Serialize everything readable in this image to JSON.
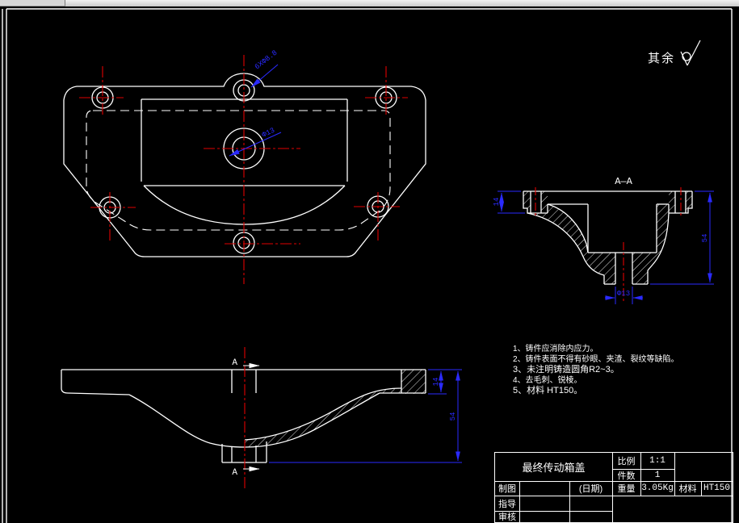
{
  "surface_finish": {
    "label": "其余"
  },
  "top_view": {
    "leader_bolt_holes": "6XΦ8.8",
    "leader_center_hole": "Φ13"
  },
  "section_view": {
    "title": "A—A",
    "dim_flange_thickness": "14",
    "dim_total_height": "54",
    "dim_center_hole": "Φ13"
  },
  "side_view": {
    "cut_label_top": "A",
    "cut_label_bottom": "A",
    "dim_flange_thickness": "14",
    "dim_total_height": "54"
  },
  "notes": {
    "lines": [
      "1、铸件应消除内应力。",
      "2、铸件表面不得有砂眼、夹渣、裂纹等缺陷。",
      "3、未注明铸造圆角R2~3。",
      "4、去毛刺、锐棱。",
      "5、材料 HT150。"
    ]
  },
  "title_block": {
    "part_name": "最终传动箱盖",
    "scale_label": "比例",
    "scale_value": "1:1",
    "qty_label": "件数",
    "qty_value": "1",
    "drafter_label": "制图",
    "date_label": "(日期)",
    "weight_label": "重量",
    "weight_value": "3.05Kg",
    "material_label": "材料",
    "material_value": "HT150",
    "supervisor_label": "指导",
    "reviewer_label": "审核"
  },
  "colors": {
    "background": "#000000",
    "line": "#ffffff",
    "centerline": "#e00000",
    "dimension": "#2a2aff"
  }
}
